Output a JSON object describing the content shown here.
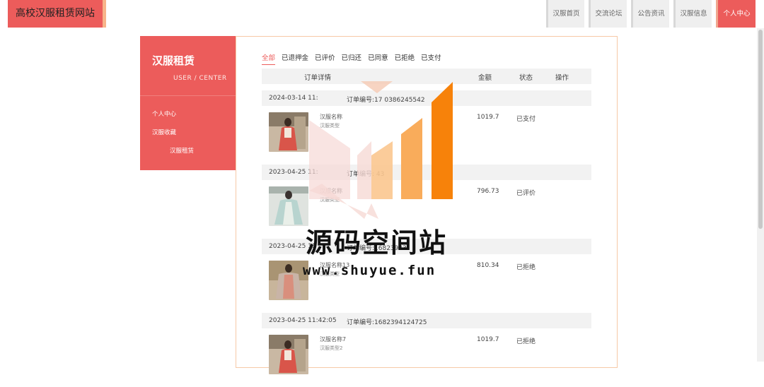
{
  "site": {
    "brand": "高校汉服租赁网站"
  },
  "nav": [
    {
      "label": "汉服首页"
    },
    {
      "label": "交流论坛"
    },
    {
      "label": "公告资讯"
    },
    {
      "label": "汉服信息"
    },
    {
      "label": "个人中心",
      "active": true
    }
  ],
  "sidebar": {
    "title": "汉服租赁",
    "subtitle": "USER / CENTER",
    "menu": [
      "个人中心",
      "汉服收藏",
      "汉服租赁"
    ]
  },
  "tabs": [
    "全部",
    "已退押金",
    "已评价",
    "已归还",
    "已同意",
    "已拒绝",
    "已支付"
  ],
  "table_header": {
    "detail": "订单详情",
    "amount": "金额",
    "status": "状态",
    "action": "操作"
  },
  "orders": [
    {
      "datetime": "2024-03-14 11:",
      "order_no": "订单编号:17  0386245542",
      "name": "汉服名称",
      "type": "汉服类型",
      "amount": "1019.7",
      "status": "已支付"
    },
    {
      "datetime": "2023-04-25 11:",
      "order_no": "订单编号:     43",
      "name": "汉服名称",
      "type": "汉服类型",
      "amount": "796.73",
      "status": "已评价"
    },
    {
      "datetime": "2023-04-25 11",
      "order_no": "订单编号:16823943",
      "name": "汉服名称13",
      "type": "汉服类型",
      "amount": "810.34",
      "status": "已拒绝"
    },
    {
      "datetime": "2023-04-25 11:42:05",
      "order_no": "订单编号:1682394124725",
      "name": "汉服名称7",
      "type": "汉服类型2",
      "amount": "1019.7",
      "status": "已拒绝"
    }
  ],
  "watermark": {
    "text": "源码空间站",
    "url": "www.shuyue.fun"
  },
  "colors": {
    "accent": "#ec5c5b",
    "accent_border": "#f7b48a",
    "orange": "#f7820a"
  }
}
